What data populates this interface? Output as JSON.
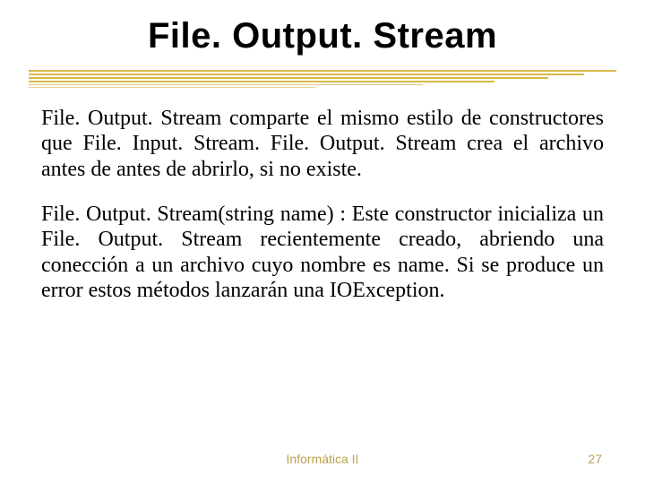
{
  "title": "File. Output. Stream",
  "paragraphs": {
    "p1": "File. Output. Stream comparte el mismo estilo de constructores que File. Input. Stream. File. Output. Stream crea el archivo antes de antes de abrirlo, si no existe.",
    "p2": "File. Output. Stream(string name) : Este constructor inicializa un File. Output. Stream recientemente creado, abriendo una conección a un archivo cuyo nombre es name. Si se produce un error estos métodos lanzarán una IOException."
  },
  "footer": {
    "course": "Informática II",
    "page": "27"
  }
}
